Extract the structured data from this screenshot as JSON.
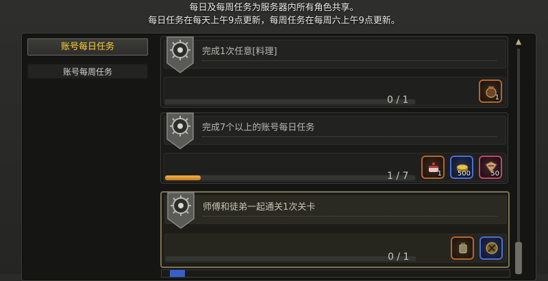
{
  "notice": {
    "line1": "每日及每周任务为服务器内所有角色共享。",
    "line2": "每日任务在每天上午9点更新，每周任务在每周六上午9点更新。"
  },
  "tabs": [
    {
      "label": "账号每日任务",
      "active": true
    },
    {
      "label": "账号每周任务",
      "active": false
    }
  ],
  "quests": [
    {
      "title": "完成1次任意[料理]",
      "progress_text": "0 / 1",
      "progress_fraction": 0,
      "highlighted": false,
      "rewards": [
        {
          "icon": "cooking-pot-icon",
          "count": "1",
          "color": "orange"
        }
      ]
    },
    {
      "title": "完成7个以上的账号每日任务",
      "progress_text": "1 / 7",
      "progress_fraction": 0.142,
      "highlighted": false,
      "rewards": [
        {
          "icon": "cake-icon",
          "count": "1",
          "color": "orange"
        },
        {
          "icon": "gold-coins-icon",
          "count": "500",
          "color": "blue"
        },
        {
          "icon": "treasure-map-icon",
          "count": "50",
          "color": "pink"
        }
      ]
    },
    {
      "title": "师傅和徒弟一起通关1次关卡",
      "progress_text": "0 / 1",
      "progress_fraction": 0,
      "highlighted": true,
      "rewards": [
        {
          "icon": "lantern-icon",
          "count": "",
          "color": "orange"
        },
        {
          "icon": "compass-medal-icon",
          "count": "",
          "color": "blue"
        }
      ]
    }
  ],
  "colors": {
    "active_tab_text": "#ffce3a",
    "progress_fill": "#e8a23a",
    "highlight_border": "#7d7553"
  }
}
